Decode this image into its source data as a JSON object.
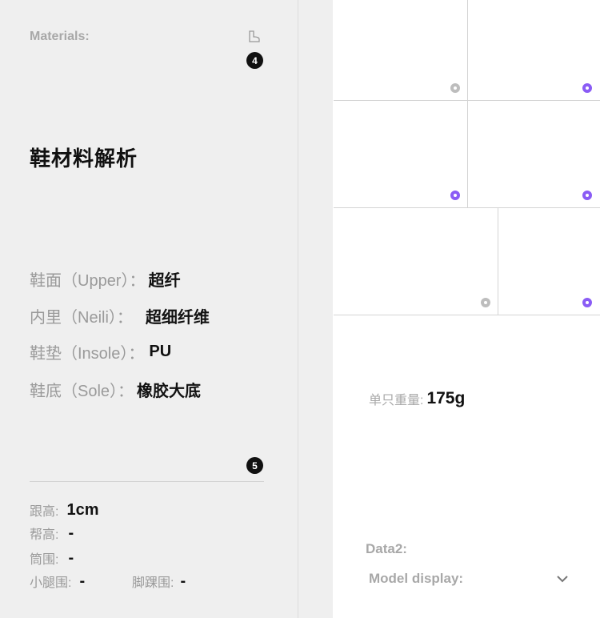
{
  "materials": {
    "label": "Materials:",
    "title": "鞋材料解析",
    "badge_top": "4",
    "rows": [
      {
        "label": "鞋面（Upper）：",
        "value": "超纤"
      },
      {
        "label": "内里（Neili）：",
        "value": "超细纤维"
      },
      {
        "label": "鞋垫（Insole）：",
        "value": "PU"
      },
      {
        "label": "鞋底（Sole）：",
        "value": "橡胶大底"
      }
    ]
  },
  "dimensions": {
    "badge": "5",
    "heel_label": "跟高:",
    "heel_value": "1cm",
    "upper_label": "帮高:",
    "upper_value": "-",
    "tube_label": "筒围:",
    "tube_value": "-",
    "calf_label": "小腿围:",
    "calf_value": "-",
    "ankle_label": "脚踝围:",
    "ankle_value": "-"
  },
  "weight": {
    "label": "单只重量:",
    "value": "175g"
  },
  "data2": {
    "label": "Data2:",
    "model_label": "Model display:"
  },
  "colors": {
    "accent": "#8a5cf5",
    "idle_dot": "#bdbdbd",
    "panel_bg": "#efefef"
  },
  "icons": [
    "boot-icon",
    "chevron-down-icon"
  ]
}
